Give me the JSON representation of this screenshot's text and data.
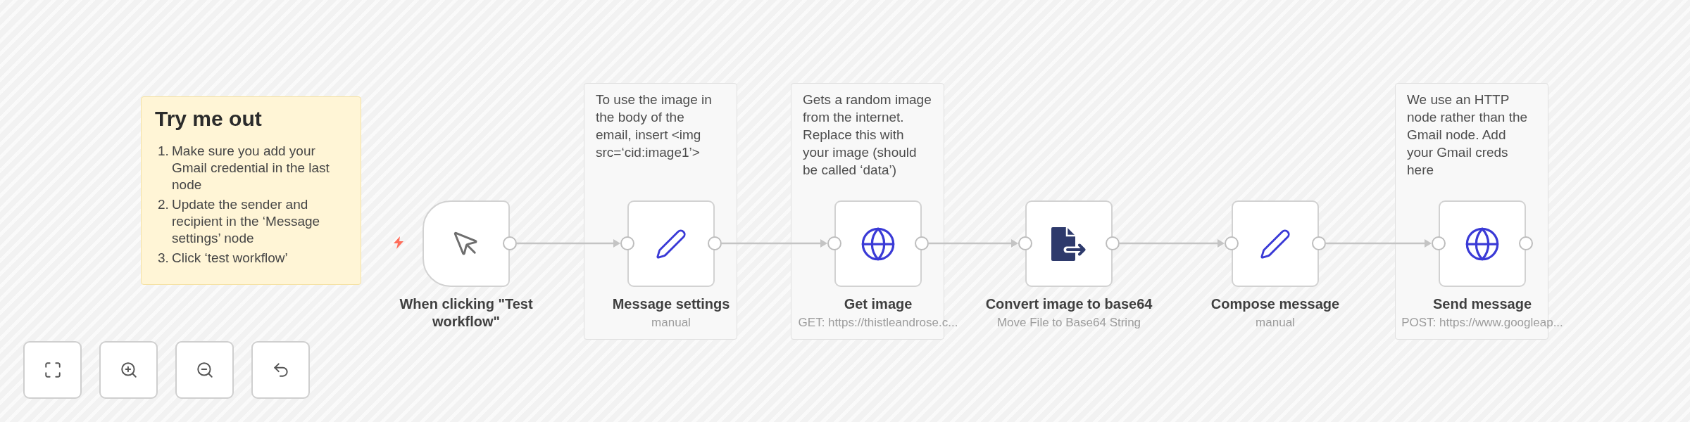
{
  "sticky_note": {
    "title": "Try me out",
    "steps": [
      {
        "number": "1.",
        "text": "Make sure you add your Gmail credential in the last node"
      },
      {
        "number": "2.",
        "text": "Update the sender and recipient in the ‘Message settings’ node"
      },
      {
        "number": "3.",
        "text": "Click ‘test workflow’"
      }
    ]
  },
  "nodes": [
    {
      "kind": "trigger",
      "title": "When clicking \"Test workflow\""
    },
    {
      "kind": "edit",
      "title": "Message settings",
      "subtitle": "manual",
      "note": "To use the image in the body of the email, insert <img src=‘cid:image1’>"
    },
    {
      "kind": "http",
      "title": "Get image",
      "subtitle": "GET: https://thistleandrose.c...",
      "note": "Gets a random image from the internet. Replace this with your image (should be called ‘data’)"
    },
    {
      "kind": "convert",
      "title": "Convert image to base64",
      "subtitle": "Move File to Base64 String"
    },
    {
      "kind": "edit",
      "title": "Compose message",
      "subtitle": "manual"
    },
    {
      "kind": "http",
      "title": "Send message",
      "subtitle": "POST: https://www.googleap...",
      "note": "We use an HTTP node rather than the Gmail node. Add your Gmail creds here"
    }
  ],
  "canvas_controls": [
    {
      "kind": "fit"
    },
    {
      "kind": "zoom_in"
    },
    {
      "kind": "zoom_out"
    },
    {
      "kind": "reset"
    }
  ]
}
